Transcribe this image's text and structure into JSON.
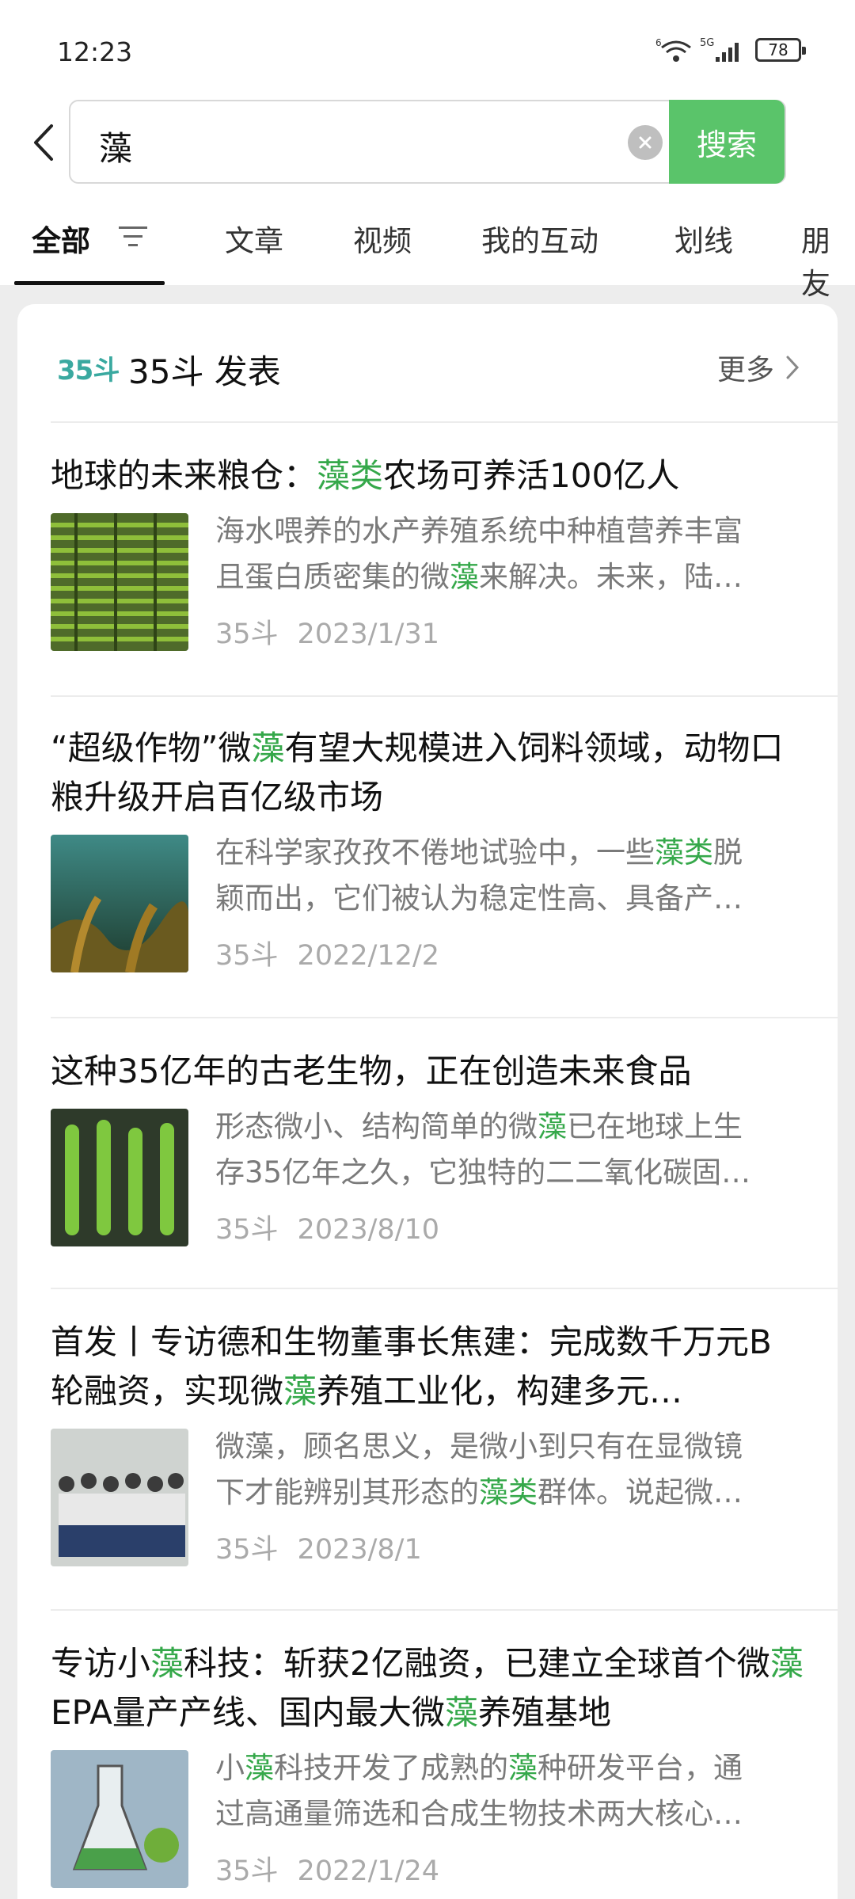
{
  "status": {
    "time": "12:23",
    "battery": "78",
    "network": "5G"
  },
  "search": {
    "query": "藻",
    "button": "搜索"
  },
  "tabs": [
    "全部",
    "文章",
    "视频",
    "我的互动",
    "划线",
    "朋友"
  ],
  "account": {
    "logo": "35斗",
    "name": "35斗 发表",
    "more": "更多"
  },
  "articles": [
    {
      "title": [
        [
          "地球的未来粮仓：",
          false
        ],
        [
          "藻类",
          true
        ],
        [
          "农场可养活100亿人",
          false
        ]
      ],
      "snippet_line1": [
        [
          "海水喂养的水产养殖系统中种植营养丰富",
          false
        ]
      ],
      "snippet_line2": [
        [
          "且蛋白质密集的微",
          false
        ],
        [
          "藻",
          true
        ],
        [
          "来解决。未来，陆…",
          false
        ]
      ],
      "source": "35斗",
      "date": "2023/1/31",
      "thumb": "algae-farm-image"
    },
    {
      "title": [
        [
          "“超级作物”微",
          false
        ],
        [
          "藻",
          true
        ],
        [
          "有望大规模进入饲料领域，动物口粮升级开启百亿级市场",
          false
        ]
      ],
      "snippet_line1": [
        [
          "在科学家孜孜不倦地试验中，一些",
          false
        ],
        [
          "藻类",
          true
        ],
        [
          "脱",
          false
        ]
      ],
      "snippet_line2": [
        [
          "颖而出，它们被认为稳定性高、具备产…",
          false
        ]
      ],
      "source": "35斗",
      "date": "2022/12/2",
      "thumb": "underwater-kelp-image"
    },
    {
      "title": [
        [
          "这种35亿年的古老生物，正在创造未来食品",
          false
        ]
      ],
      "snippet_line1": [
        [
          "形态微小、结构简单的微",
          false
        ],
        [
          "藻",
          true
        ],
        [
          "已在地球上生",
          false
        ]
      ],
      "snippet_line2": [
        [
          "存35亿年之久，它独特的二二氧化碳固…",
          false
        ]
      ],
      "source": "35斗",
      "date": "2023/8/10",
      "thumb": "test-tubes-image"
    },
    {
      "title": [
        [
          "首发丨专访德和生物董事长焦建：完成数千万元B轮融资，实现微",
          false
        ],
        [
          "藻",
          true
        ],
        [
          "养殖工业化，构建多元…",
          false
        ]
      ],
      "snippet_line1": [
        [
          "微藻，顾名思义，是微小到只有在显微镜",
          false
        ]
      ],
      "snippet_line2": [
        [
          "下才能辨别其形态的",
          false
        ],
        [
          "藻类",
          true
        ],
        [
          "群体。说起微…",
          false
        ]
      ],
      "source": "35斗",
      "date": "2023/8/1",
      "thumb": "team-photo-image"
    },
    {
      "title": [
        [
          "专访小",
          false
        ],
        [
          "藻",
          true
        ],
        [
          "科技：斩获2亿融资，已建立全球首个微",
          false
        ],
        [
          "藻",
          true
        ],
        [
          "EPA量产产线、国内最大微",
          false
        ],
        [
          "藻",
          true
        ],
        [
          "养殖基地",
          false
        ]
      ],
      "snippet_line1": [
        [
          "小",
          false
        ],
        [
          "藻",
          true
        ],
        [
          "科技开发了成熟的",
          false
        ],
        [
          "藻",
          true
        ],
        [
          "种研发平台，通",
          false
        ]
      ],
      "snippet_line2": [
        [
          "过高通量筛选和合成生物技术两大核心…",
          false
        ]
      ],
      "source": "35斗",
      "date": "2022/1/24",
      "thumb": "lab-flask-image"
    }
  ]
}
